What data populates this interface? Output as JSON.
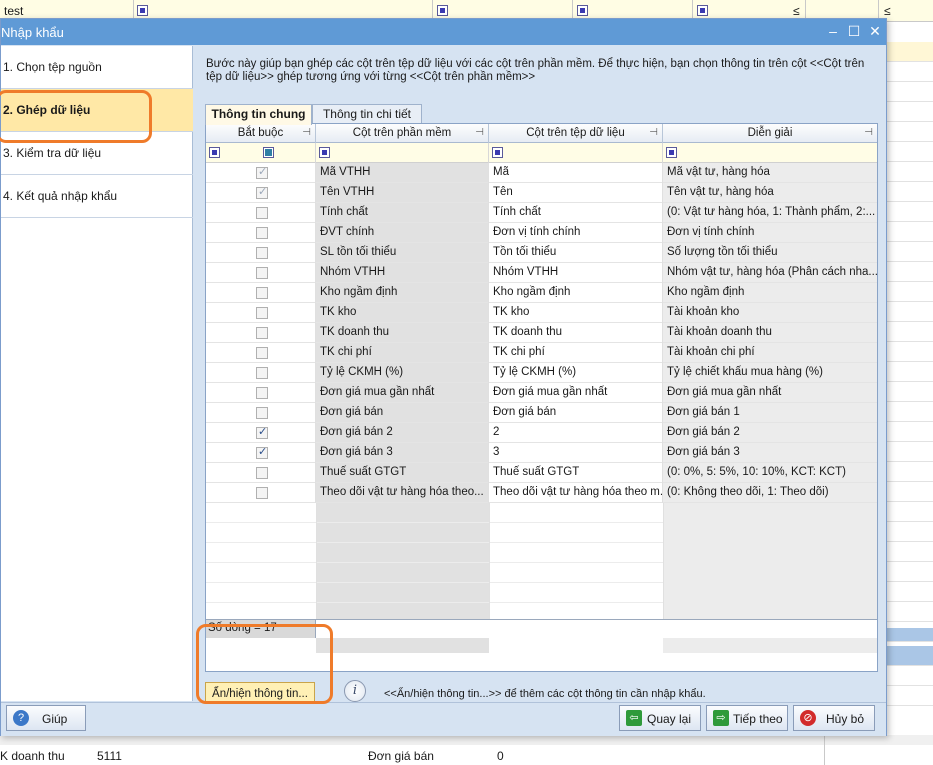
{
  "background": {
    "top_cell": "test",
    "top_markers": [
      "≤",
      "≤"
    ],
    "bottom_label": "K doanh thu",
    "bottom_value": "5111",
    "bottom_label2": "Đơn giá bán",
    "bottom_value2": "0"
  },
  "window": {
    "title": "Nhập khẩu",
    "minimize_glyph": "–",
    "maximize_glyph": "☐",
    "close_glyph": "✕"
  },
  "steps": [
    {
      "label": "1. Chọn tệp nguồn"
    },
    {
      "label": "2. Ghép dữ liệu"
    },
    {
      "label": "3. Kiểm tra dữ liệu"
    },
    {
      "label": "4. Kết quả nhập khẩu"
    }
  ],
  "description": "Bước này giúp bạn ghép các cột trên tệp dữ liệu với các cột trên phần mềm. Để thực hiện, bạn chọn thông tin trên cột <<Cột trên tệp dữ liệu>> ghép tương ứng với từng <<Cột trên phần mềm>>",
  "tabs": [
    {
      "label": "Thông tin chung"
    },
    {
      "label": "Thông tin chi tiết"
    }
  ],
  "grid": {
    "columns": [
      "Bắt buộc",
      "Cột trên phần mềm",
      "Cột trên tệp dữ liệu",
      "Diễn giải"
    ],
    "pin_glyph": "⊣",
    "rows": [
      {
        "checked": true,
        "dim": true,
        "software": "Mã VTHH",
        "file": "Mã",
        "desc": "Mã vật tư, hàng hóa"
      },
      {
        "checked": true,
        "dim": true,
        "software": "Tên VTHH",
        "file": "Tên",
        "desc": "Tên vật tư, hàng hóa"
      },
      {
        "checked": false,
        "dim": false,
        "software": "Tính chất",
        "file": "Tính chất",
        "desc": "(0: Vật tư hàng hóa, 1: Thành phẩm, 2:..."
      },
      {
        "checked": false,
        "dim": false,
        "software": "ĐVT chính",
        "file": "Đơn vị tính chính",
        "desc": "Đơn vị tính chính"
      },
      {
        "checked": false,
        "dim": false,
        "software": "SL tồn tối thiểu",
        "file": "Tồn tối thiểu",
        "desc": "Số lượng tồn tối thiểu"
      },
      {
        "checked": false,
        "dim": false,
        "software": "Nhóm VTHH",
        "file": "Nhóm VTHH",
        "desc": "Nhóm vật tư, hàng hóa (Phân cách nha..."
      },
      {
        "checked": false,
        "dim": false,
        "software": "Kho ngầm định",
        "file": "Kho ngầm định",
        "desc": "Kho ngầm định"
      },
      {
        "checked": false,
        "dim": false,
        "software": "TK kho",
        "file": "TK kho",
        "desc": "Tài khoản kho"
      },
      {
        "checked": false,
        "dim": false,
        "software": "TK doanh thu",
        "file": "TK doanh thu",
        "desc": "Tài khoản doanh thu"
      },
      {
        "checked": false,
        "dim": false,
        "software": "TK chi phí",
        "file": "TK chi phí",
        "desc": "Tài khoản chi phí"
      },
      {
        "checked": false,
        "dim": false,
        "software": "Tỷ lệ CKMH (%)",
        "file": "Tỷ lệ CKMH (%)",
        "desc": "Tỷ lệ chiết khấu mua hàng (%)"
      },
      {
        "checked": false,
        "dim": false,
        "software": "Đơn giá mua gần nhất",
        "file": "Đơn giá mua gần nhất",
        "desc": "Đơn giá mua gần nhất"
      },
      {
        "checked": false,
        "dim": false,
        "software": "Đơn giá bán",
        "file": "Đơn giá bán",
        "desc": "Đơn giá bán 1"
      },
      {
        "checked": true,
        "dim": false,
        "software": "Đơn giá bán 2",
        "file": "2",
        "desc": "Đơn giá bán 2"
      },
      {
        "checked": true,
        "dim": false,
        "software": "Đơn giá bán 3",
        "file": "3",
        "desc": "Đơn giá bán 3"
      },
      {
        "checked": false,
        "dim": false,
        "software": "Thuế suất GTGT",
        "file": "Thuế suất GTGT",
        "desc": "(0: 0%, 5: 5%, 10: 10%, KCT: KCT)"
      },
      {
        "checked": false,
        "dim": false,
        "software": "Theo dõi vật tư hàng hóa theo...",
        "file": "Theo dõi vật tư hàng hóa theo m...",
        "desc": "(0: Không theo dõi, 1: Theo dõi)"
      }
    ],
    "row_count_label": "Số dòng = 17"
  },
  "showhide": {
    "button_label": "Ẩn/hiện thông tin...",
    "info_glyph": "i",
    "info_text": "<<Ẩn/hiện thông tin...>> để thêm các cột thông tin cần nhập khẩu."
  },
  "buttons": {
    "help": "Giúp",
    "back": "Quay lại",
    "next": "Tiếp theo",
    "cancel": "Hủy bỏ"
  },
  "colors": {
    "highlight_ring": "#ef7b2a",
    "active_step": "#ffe8a6",
    "title_bar": "#5f9ad6"
  }
}
